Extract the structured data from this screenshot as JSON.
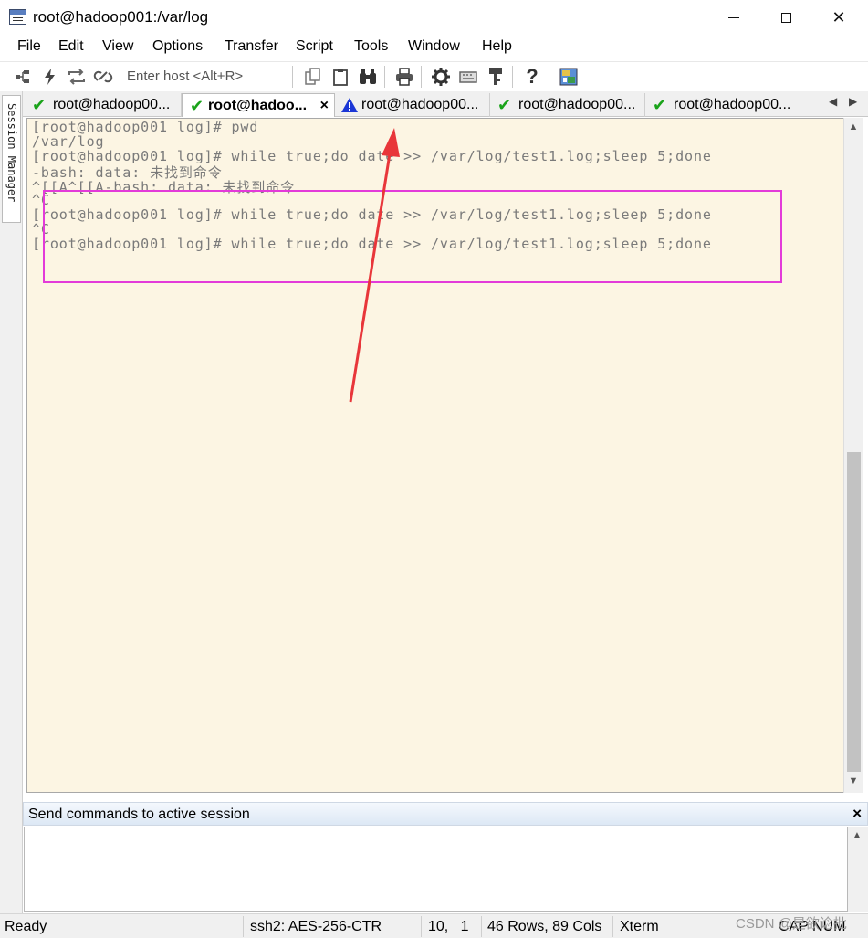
{
  "window": {
    "title": "root@hadoop001:/var/log",
    "controls": {
      "minimize": "",
      "maximize": "",
      "close": "✕"
    }
  },
  "menu": [
    "File",
    "Edit",
    "View",
    "Options",
    "Transfer",
    "Script",
    "Tools",
    "Window",
    "Help"
  ],
  "toolbar": {
    "host_placeholder": "Enter host <Alt+R>",
    "icons": [
      "connect-icon",
      "quick-connect-icon",
      "reconnect-icon",
      "disconnect-icon",
      "copy-icon",
      "paste-icon",
      "find-icon",
      "print-icon",
      "settings-icon",
      "keymap-icon",
      "key-icon",
      "help-icon",
      "sftp-icon"
    ]
  },
  "session_manager": {
    "label": "Session Manager"
  },
  "tabs": [
    {
      "label": "root@hadoop00...",
      "icon": "check-icon",
      "active": false
    },
    {
      "label": "root@hadoo...",
      "icon": "check-icon",
      "active": true,
      "close": "×"
    },
    {
      "label": "root@hadoop00...",
      "icon": "warning-icon",
      "active": false
    },
    {
      "label": "root@hadoop00...",
      "icon": "check-icon",
      "active": false
    },
    {
      "label": "root@hadoop00...",
      "icon": "check-icon",
      "active": false
    }
  ],
  "tab_nav": {
    "prev": "◀",
    "next": "▶"
  },
  "terminal": {
    "lines": [
      "[root@hadoop001 log]# pwd",
      "/var/log",
      "[root@hadoop001 log]# while true;do date >> /var/log/test1.log;sleep 5;done",
      "-bash: data: 未找到命令",
      "^[[A^[[A-bash: data: 未找到命令",
      "^C",
      "[root@hadoop001 log]# while true;do date >> /var/log/test1.log;sleep 5;done",
      "^C",
      "[root@hadoop001 log]# while true;do date >> /var/log/test1.log;sleep 5;done"
    ]
  },
  "command_window": {
    "title": "Send commands to active session",
    "close": "×"
  },
  "status": {
    "state": "Ready",
    "cipher": "ssh2: AES-256-CTR",
    "cursor": "10,   1",
    "size": "46 Rows, 89 Cols",
    "terminal_type": "Xterm",
    "keys": "CAP NUM"
  },
  "watermark": "CSDN @是欲谂批",
  "colors": {
    "terminal_bg": "#fcf5e3",
    "highlight": "#e33ad9",
    "arrow": "#e8363a"
  }
}
